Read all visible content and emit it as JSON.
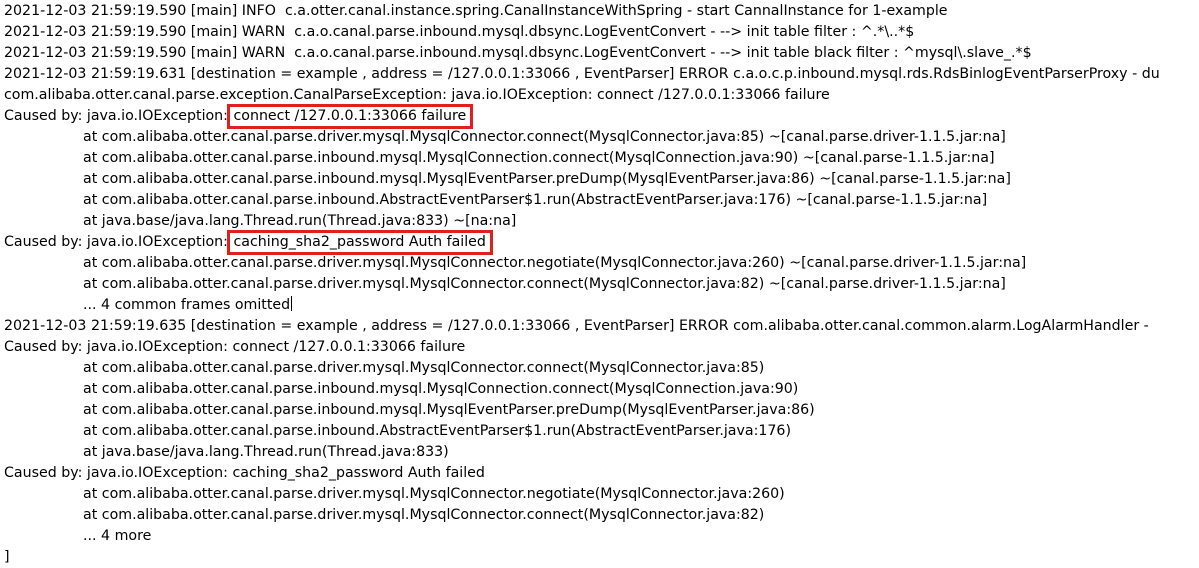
{
  "log": {
    "lines": [
      {
        "text": "2021-12-03 21:59:19.590 [main] INFO  c.a.otter.canal.instance.spring.CanalInstanceWithSpring - start CannalInstance for 1-example",
        "indent": false
      },
      {
        "text": "2021-12-03 21:59:19.590 [main] WARN  c.a.o.canal.parse.inbound.mysql.dbsync.LogEventConvert - --> init table filter : ^.*\\..*$",
        "indent": false
      },
      {
        "text": "2021-12-03 21:59:19.590 [main] WARN  c.a.o.canal.parse.inbound.mysql.dbsync.LogEventConvert - --> init table black filter : ^mysql\\.slave_.*$",
        "indent": false
      },
      {
        "text": "2021-12-03 21:59:19.631 [destination = example , address = /127.0.0.1:33066 , EventParser] ERROR c.a.o.c.p.inbound.mysql.rds.RdsBinlogEventParserProxy - du",
        "indent": false
      },
      {
        "text": "com.alibaba.otter.canal.parse.exception.CanalParseException: java.io.IOException: connect /127.0.0.1:33066 failure",
        "indent": false
      },
      {
        "text": "Caused by: java.io.IOException: ",
        "highlight": "connect /127.0.0.1:33066 failure",
        "indent": false
      },
      {
        "text": "at com.alibaba.otter.canal.parse.driver.mysql.MysqlConnector.connect(MysqlConnector.java:85) ~[canal.parse.driver-1.1.5.jar:na]",
        "indent": true
      },
      {
        "text": "at com.alibaba.otter.canal.parse.inbound.mysql.MysqlConnection.connect(MysqlConnection.java:90) ~[canal.parse-1.1.5.jar:na]",
        "indent": true
      },
      {
        "text": "at com.alibaba.otter.canal.parse.inbound.mysql.MysqlEventParser.preDump(MysqlEventParser.java:86) ~[canal.parse-1.1.5.jar:na]",
        "indent": true
      },
      {
        "text": "at com.alibaba.otter.canal.parse.inbound.AbstractEventParser$1.run(AbstractEventParser.java:176) ~[canal.parse-1.1.5.jar:na]",
        "indent": true
      },
      {
        "text": "at java.base/java.lang.Thread.run(Thread.java:833) ~[na:na]",
        "indent": true
      },
      {
        "text": "Caused by: java.io.IOException: ",
        "highlight": "caching_sha2_password Auth failed",
        "indent": false
      },
      {
        "text": "at com.alibaba.otter.canal.parse.driver.mysql.MysqlConnector.negotiate(MysqlConnector.java:260) ~[canal.parse.driver-1.1.5.jar:na]",
        "indent": true
      },
      {
        "text": "at com.alibaba.otter.canal.parse.driver.mysql.MysqlConnector.connect(MysqlConnector.java:82) ~[canal.parse.driver-1.1.5.jar:na]",
        "indent": true
      },
      {
        "text": "... 4 common frames omitted",
        "indent": true,
        "cursor": true
      },
      {
        "text": "2021-12-03 21:59:19.635 [destination = example , address = /127.0.0.1:33066 , EventParser] ERROR com.alibaba.otter.canal.common.alarm.LogAlarmHandler - ",
        "indent": false
      },
      {
        "text": "Caused by: java.io.IOException: connect /127.0.0.1:33066 failure",
        "indent": false
      },
      {
        "text": "at com.alibaba.otter.canal.parse.driver.mysql.MysqlConnector.connect(MysqlConnector.java:85)",
        "indent": true
      },
      {
        "text": "at com.alibaba.otter.canal.parse.inbound.mysql.MysqlConnection.connect(MysqlConnection.java:90)",
        "indent": true
      },
      {
        "text": "at com.alibaba.otter.canal.parse.inbound.mysql.MysqlEventParser.preDump(MysqlEventParser.java:86)",
        "indent": true
      },
      {
        "text": "at com.alibaba.otter.canal.parse.inbound.AbstractEventParser$1.run(AbstractEventParser.java:176)",
        "indent": true
      },
      {
        "text": "at java.base/java.lang.Thread.run(Thread.java:833)",
        "indent": true
      },
      {
        "text": "Caused by: java.io.IOException: caching_sha2_password Auth failed",
        "indent": false
      },
      {
        "text": "at com.alibaba.otter.canal.parse.driver.mysql.MysqlConnector.negotiate(MysqlConnector.java:260)",
        "indent": true
      },
      {
        "text": "at com.alibaba.otter.canal.parse.driver.mysql.MysqlConnector.connect(MysqlConnector.java:82)",
        "indent": true
      },
      {
        "text": "... 4 more",
        "indent": true
      },
      {
        "text": "]",
        "indent": false
      }
    ],
    "highlight_color": "#e01f1f"
  }
}
